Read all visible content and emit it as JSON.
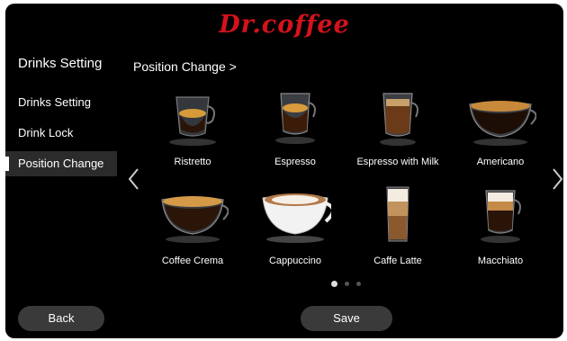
{
  "brand": "Dr.coffee",
  "sidebar": {
    "title": "Drinks Setting",
    "items": [
      {
        "label": "Drinks Setting",
        "active": false
      },
      {
        "label": "Drink Lock",
        "active": false
      },
      {
        "label": "Position Change",
        "active": true
      }
    ]
  },
  "breadcrumb": "Position Change >",
  "drinks": [
    {
      "label": "Ristretto",
      "icon": "ristretto-cup-icon"
    },
    {
      "label": "Espresso",
      "icon": "espresso-cup-icon"
    },
    {
      "label": "Espresso with Milk",
      "icon": "espresso-milk-glass-icon"
    },
    {
      "label": "Americano",
      "icon": "americano-cup-icon"
    },
    {
      "label": "Coffee Crema",
      "icon": "coffee-crema-cup-icon"
    },
    {
      "label": "Cappuccino",
      "icon": "cappuccino-cup-icon"
    },
    {
      "label": "Caffe Latte",
      "icon": "caffe-latte-glass-icon"
    },
    {
      "label": "Macchiato",
      "icon": "macchiato-glass-icon"
    }
  ],
  "pager": {
    "pages": 3,
    "current": 1
  },
  "buttons": {
    "back": "Back",
    "save": "Save"
  },
  "colors": {
    "brand": "#d5121c",
    "background": "#000000",
    "button": "#3a3a3a"
  }
}
